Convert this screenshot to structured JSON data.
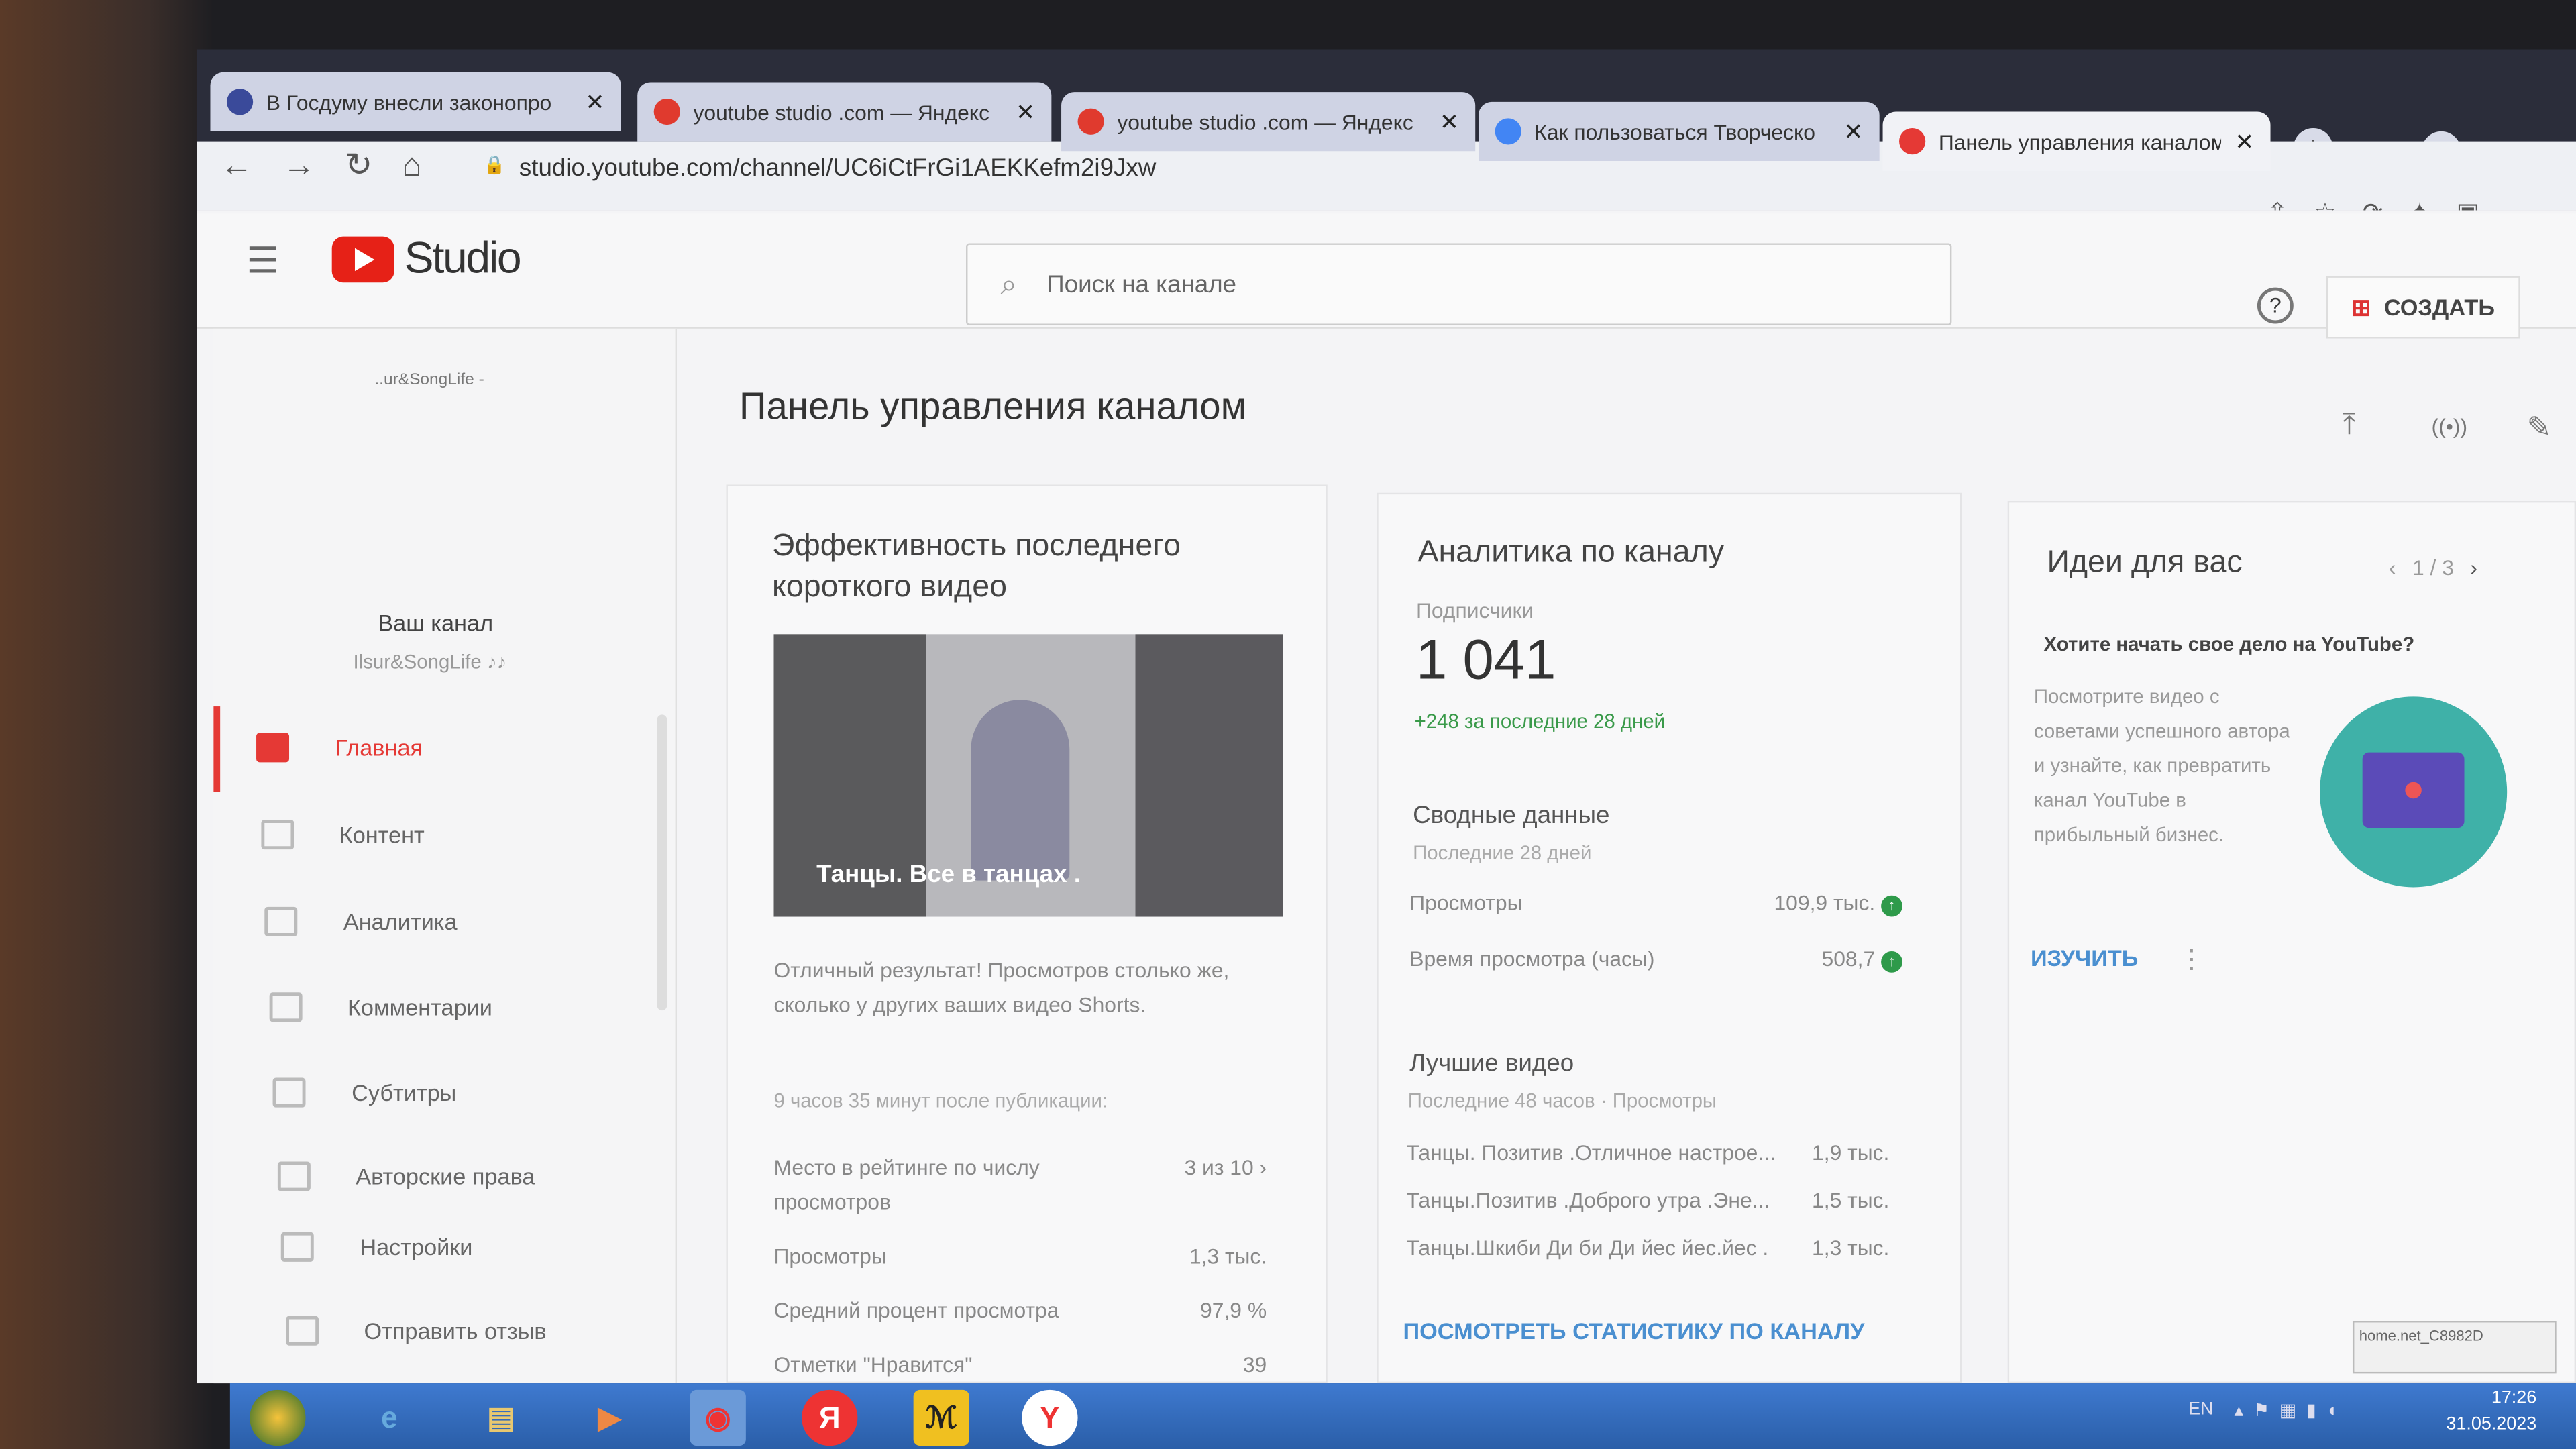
{
  "browser": {
    "tabs": [
      {
        "title": "В Госдуму внесли законопро",
        "icon": "news-icon",
        "color": "#3a4a9a"
      },
      {
        "title": "youtube studio .com — Яндекс",
        "icon": "yandex-icon",
        "color": "#e03a2e"
      },
      {
        "title": "youtube studio .com — Яндекс",
        "icon": "yandex-icon",
        "color": "#e03a2e"
      },
      {
        "title": "Как пользоваться Творческо",
        "icon": "google-icon",
        "color": "#4285f4"
      },
      {
        "title": "Панель управления каналом",
        "icon": "youtube-icon",
        "color": "#e53935"
      }
    ],
    "url": "studio.youtube.com/channel/UC6iCtFrGi1AEKKefm2i9Jxw"
  },
  "header": {
    "logo": "Studio",
    "search_placeholder": "Поиск на канале",
    "create": "СОЗДАТЬ",
    "help": "?"
  },
  "sidebar": {
    "channel_banner": "..ur&SongLife -",
    "your_channel": "Ваш канал",
    "handle": "Ilsur&SongLife ♪♪",
    "items": [
      {
        "label": "Главная",
        "active": true
      },
      {
        "label": "Контент"
      },
      {
        "label": "Аналитика"
      },
      {
        "label": "Комментарии"
      },
      {
        "label": "Субтитры"
      },
      {
        "label": "Авторские права"
      },
      {
        "label": "Настройки"
      },
      {
        "label": "Отправить отзыв"
      }
    ]
  },
  "main": {
    "title": "Панель управления каналом",
    "short_card": {
      "title": "Эффективность последнего короткого видео",
      "thumb_caption": "Танцы. Все в танцах .",
      "result": "Отличный результат! Просмотров столько же, сколько у других ваших видео Shorts.",
      "since": "9 часов 35 минут после публикации:",
      "stats": [
        {
          "label": "Место в рейтинге по числу просмотров",
          "value": "3 из 10"
        },
        {
          "label": "Просмотры",
          "value": "1,3 тыс."
        },
        {
          "label": "Средний процент просмотра",
          "value": "97,9 %"
        },
        {
          "label": "Отметки \"Нравится\"",
          "value": "39"
        }
      ]
    },
    "analytics": {
      "title": "Аналитика по каналу",
      "subs_label": "Подписчики",
      "subs": "1 041",
      "subs_delta": "+248 за последние 28 дней",
      "summary_title": "Сводные данные",
      "summary_period": "Последние 28 дней",
      "summary": [
        {
          "label": "Просмотры",
          "value": "109,9 тыс."
        },
        {
          "label": "Время просмотра (часы)",
          "value": "508,7"
        }
      ],
      "top_title": "Лучшие видео",
      "top_period": "Последние 48 часов · Просмотры",
      "top": [
        {
          "title": "Танцы. Позитив .Отличное настрое...",
          "value": "1,9 тыс."
        },
        {
          "title": "Танцы.Позитив .Доброго утра .Эне...",
          "value": "1,5 тыс."
        },
        {
          "title": "Танцы.Шкиби Ди би Ди йес йес.йес .",
          "value": "1,3 тыс."
        }
      ],
      "link": "ПОСМОТРЕТЬ СТАТИСТИКУ ПО КАНАЛУ"
    },
    "ideas": {
      "title": "Идеи для вас",
      "pager": "1 / 3",
      "headline": "Хотите начать свое дело на YouTube?",
      "body": "Посмотрите видео с советами успешного автора и узнайте, как превратить канал YouTube в прибыльный бизнес.",
      "link": "ИЗУЧИТЬ"
    }
  },
  "taskbar": {
    "lang": "EN",
    "time": "17:26",
    "date": "31.05.2023",
    "network_tooltip": "home.net_C8982D"
  }
}
